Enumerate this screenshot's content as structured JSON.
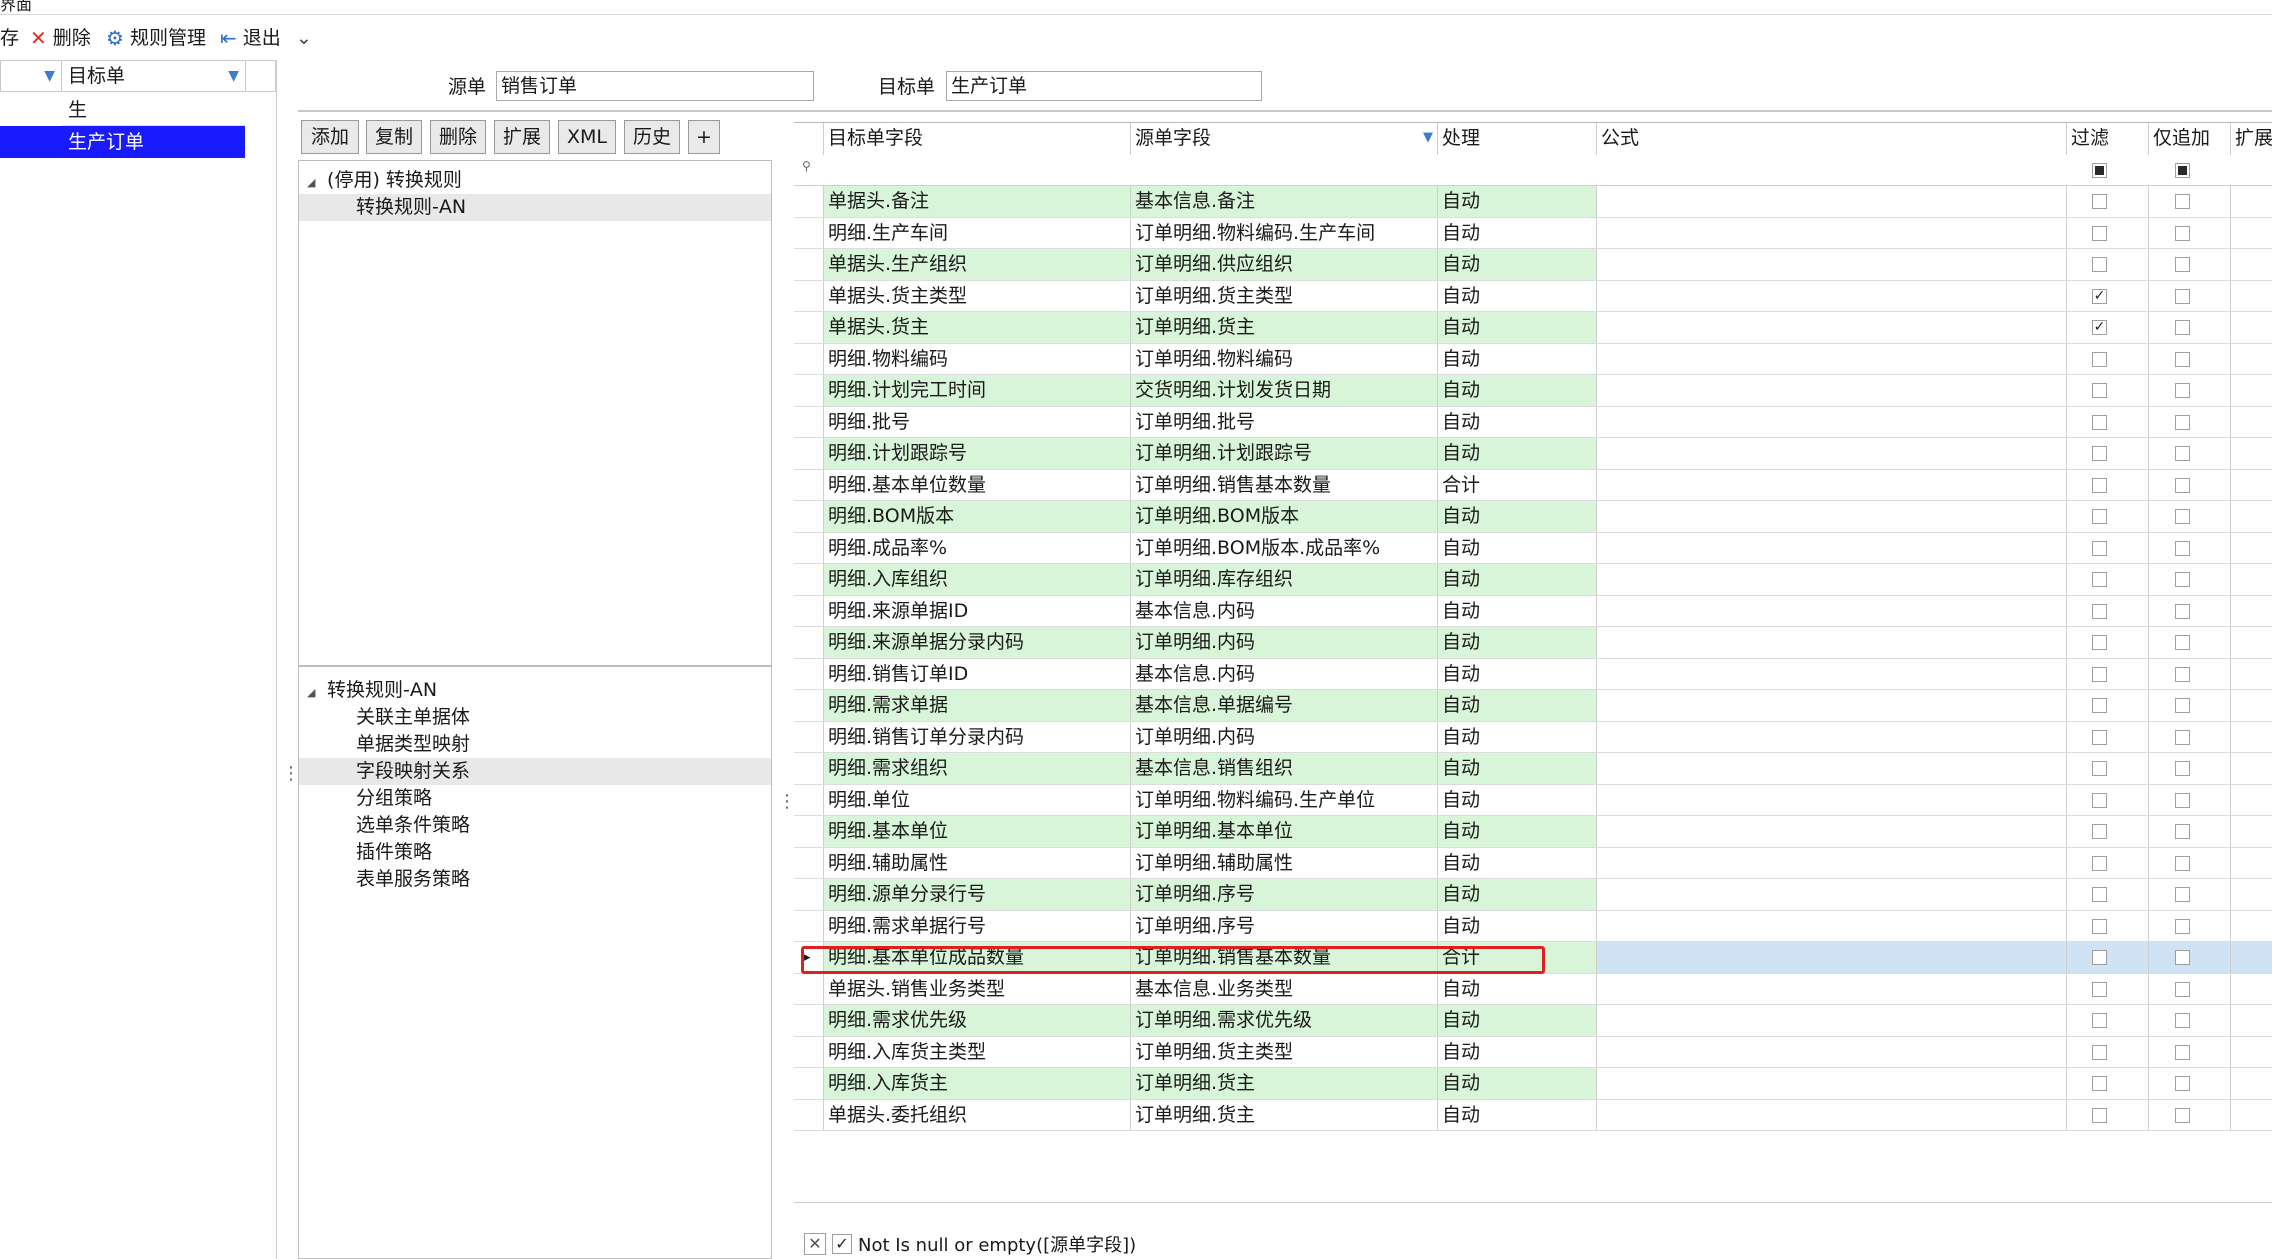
{
  "window": {
    "title_fragment": "界面"
  },
  "toolbar": {
    "items": [
      {
        "label": "存",
        "icon": "save-icon"
      },
      {
        "label": "删除",
        "icon": "delete-x-icon"
      },
      {
        "label": "规则管理",
        "icon": "rules-icon"
      },
      {
        "label": "退出",
        "icon": "exit-icon"
      }
    ],
    "dropdown_glyph": "⌄"
  },
  "left_pane": {
    "header": "目标单",
    "rows": [
      "生",
      "生产订单"
    ],
    "selected_index": 1
  },
  "source_target": {
    "source_label": "源单",
    "source_value": "销售订单",
    "target_label": "目标单",
    "target_value": "生产订单"
  },
  "buttons": [
    "添加",
    "复制",
    "删除",
    "扩展",
    "XML",
    "历史",
    "+"
  ],
  "rule_tree": {
    "root": "(停用) 转换规则",
    "child": "转换规则-AN"
  },
  "policy_tree": {
    "root": "转换规则-AN",
    "children": [
      "关联主单据体",
      "单据类型映射",
      "字段映射关系",
      "分组策略",
      "选单条件策略",
      "插件策略",
      "表单服务策略"
    ],
    "selected_index": 2
  },
  "grid": {
    "columns": [
      "目标单字段",
      "源单字段",
      "处理",
      "公式",
      "过滤",
      "仅追加",
      "扩展"
    ],
    "rows": [
      {
        "target": "单据头.备注",
        "source": "基本信息.备注",
        "process": "自动",
        "filter": false,
        "append": false
      },
      {
        "target": "明细.生产车间",
        "source": "订单明细.物料编码.生产车间",
        "process": "自动",
        "filter": false,
        "append": false
      },
      {
        "target": "单据头.生产组织",
        "source": "订单明细.供应组织",
        "process": "自动",
        "filter": false,
        "append": false
      },
      {
        "target": "单据头.货主类型",
        "source": "订单明细.货主类型",
        "process": "自动",
        "filter": true,
        "append": false
      },
      {
        "target": "单据头.货主",
        "source": "订单明细.货主",
        "process": "自动",
        "filter": true,
        "append": false
      },
      {
        "target": "明细.物料编码",
        "source": "订单明细.物料编码",
        "process": "自动",
        "filter": false,
        "append": false
      },
      {
        "target": "明细.计划完工时间",
        "source": "交货明细.计划发货日期",
        "process": "自动",
        "filter": false,
        "append": false
      },
      {
        "target": "明细.批号",
        "source": "订单明细.批号",
        "process": "自动",
        "filter": false,
        "append": false
      },
      {
        "target": "明细.计划跟踪号",
        "source": "订单明细.计划跟踪号",
        "process": "自动",
        "filter": false,
        "append": false
      },
      {
        "target": "明细.基本单位数量",
        "source": "订单明细.销售基本数量",
        "process": "合计",
        "filter": false,
        "append": false
      },
      {
        "target": "明细.BOM版本",
        "source": "订单明细.BOM版本",
        "process": "自动",
        "filter": false,
        "append": false
      },
      {
        "target": "明细.成品率%",
        "source": "订单明细.BOM版本.成品率%",
        "process": "自动",
        "filter": false,
        "append": false
      },
      {
        "target": "明细.入库组织",
        "source": "订单明细.库存组织",
        "process": "自动",
        "filter": false,
        "append": false
      },
      {
        "target": "明细.来源单据ID",
        "source": "基本信息.内码",
        "process": "自动",
        "filter": false,
        "append": false
      },
      {
        "target": "明细.来源单据分录内码",
        "source": "订单明细.内码",
        "process": "自动",
        "filter": false,
        "append": false
      },
      {
        "target": "明细.销售订单ID",
        "source": "基本信息.内码",
        "process": "自动",
        "filter": false,
        "append": false
      },
      {
        "target": "明细.需求单据",
        "source": "基本信息.单据编号",
        "process": "自动",
        "filter": false,
        "append": false
      },
      {
        "target": "明细.销售订单分录内码",
        "source": "订单明细.内码",
        "process": "自动",
        "filter": false,
        "append": false
      },
      {
        "target": "明细.需求组织",
        "source": "基本信息.销售组织",
        "process": "自动",
        "filter": false,
        "append": false
      },
      {
        "target": "明细.单位",
        "source": "订单明细.物料编码.生产单位",
        "process": "自动",
        "filter": false,
        "append": false
      },
      {
        "target": "明细.基本单位",
        "source": "订单明细.基本单位",
        "process": "自动",
        "filter": false,
        "append": false
      },
      {
        "target": "明细.辅助属性",
        "source": "订单明细.辅助属性",
        "process": "自动",
        "filter": false,
        "append": false
      },
      {
        "target": "明细.源单分录行号",
        "source": "订单明细.序号",
        "process": "自动",
        "filter": false,
        "append": false
      },
      {
        "target": "明细.需求单据行号",
        "source": "订单明细.序号",
        "process": "自动",
        "filter": false,
        "append": false
      },
      {
        "target": "明细.基本单位成品数量",
        "source": "订单明细.销售基本数量",
        "process": "合计",
        "filter": false,
        "append": false
      },
      {
        "target": "单据头.销售业务类型",
        "source": "基本信息.业务类型",
        "process": "自动",
        "filter": false,
        "append": false
      },
      {
        "target": "明细.需求优先级",
        "source": "订单明细.需求优先级",
        "process": "自动",
        "filter": false,
        "append": false
      },
      {
        "target": "明细.入库货主类型",
        "source": "订单明细.货主类型",
        "process": "自动",
        "filter": false,
        "append": false
      },
      {
        "target": "明细.入库货主",
        "source": "订单明细.货主",
        "process": "自动",
        "filter": false,
        "append": false
      },
      {
        "target": "单据头.委托组织",
        "source": "订单明细.货主",
        "process": "自动",
        "filter": false,
        "append": false
      }
    ],
    "highlighted_row_index": 24
  },
  "filter_bar": {
    "expression": "Not Is null or empty([源单字段])",
    "enabled": true
  },
  "colors": {
    "row_green": "#d9f5d9",
    "selection_blue": "#1a1aff",
    "highlight_red": "#e02020"
  }
}
